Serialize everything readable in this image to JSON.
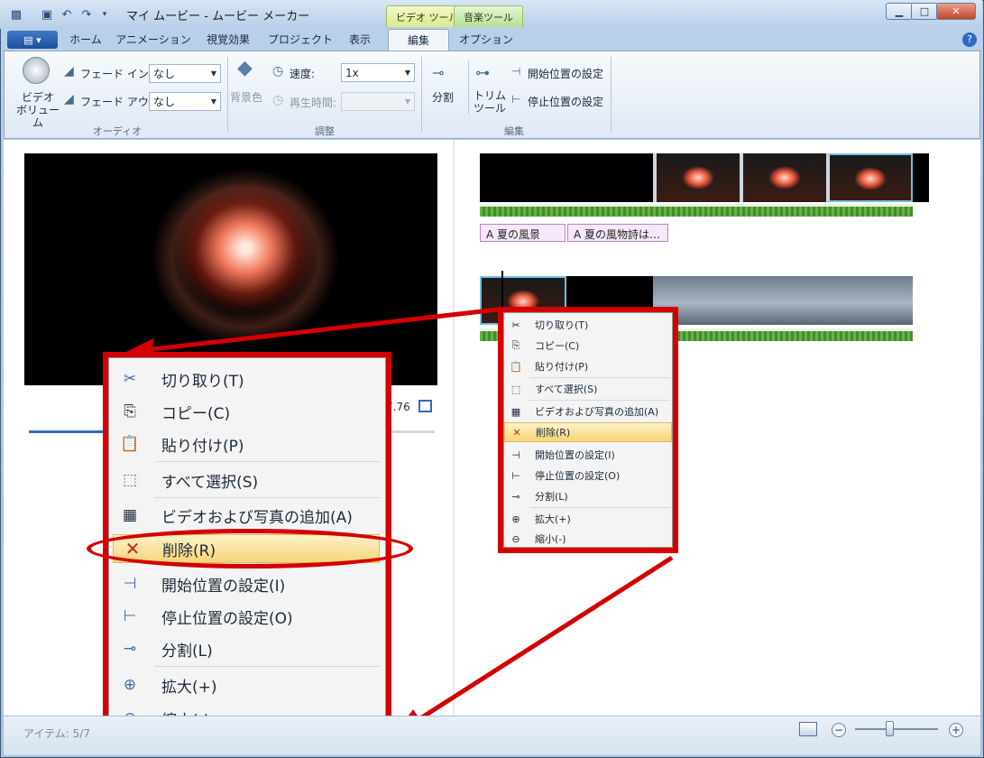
{
  "window": {
    "title": "マイ ムービー - ムービー メーカー",
    "context_tabs": [
      "ビデオ ツール",
      "音楽ツール"
    ],
    "controls": {
      "minimize": "▁",
      "maximize": "□",
      "close": "✕"
    }
  },
  "ribbon": {
    "app_menu_label": "▤ ▾",
    "tabs": [
      "ホーム",
      "アニメーション",
      "視覚効果",
      "プロジェクト",
      "表示",
      "編集",
      "オプション"
    ],
    "active_tab": "編集",
    "help": "?",
    "audio": {
      "video_volume": "ビデオ\nボリューム",
      "fade_in_label": "フェード イン:",
      "fade_in_value": "なし",
      "fade_out_label": "フェード アウト:",
      "fade_out_value": "なし",
      "group": "オーディオ"
    },
    "adjust": {
      "background_color": "背景色",
      "speed_label": "速度:",
      "speed_value": "1x",
      "duration_label": "再生時間:",
      "duration_value": "",
      "group": "調整"
    },
    "edit": {
      "split": "分割",
      "trim_tool": "トリム\nツール",
      "set_start": "開始位置の設定",
      "set_end": "停止位置の設定",
      "group": "編集"
    }
  },
  "preview": {
    "time_fragment": "7.76"
  },
  "storyboard": {
    "captions": [
      "A 夏の風景",
      "A 夏の風物詩は…"
    ]
  },
  "context_menu_items": [
    {
      "icon": "✂",
      "label": "切り取り(T)"
    },
    {
      "icon": "⎘",
      "label": "コピー(C)"
    },
    {
      "icon": "📋",
      "label": "貼り付け(P)"
    },
    {
      "icon": "⬚",
      "label": "すべて選択(S)"
    },
    {
      "icon": "▦",
      "label": "ビデオおよび写真の追加(A)"
    },
    {
      "icon": "✕",
      "label": "削除(R)",
      "highlighted": true
    },
    {
      "icon": "⊣",
      "label": "開始位置の設定(I)"
    },
    {
      "icon": "⊢",
      "label": "停止位置の設定(O)"
    },
    {
      "icon": "⊸",
      "label": "分割(L)"
    },
    {
      "icon": "⊕",
      "label": "拡大(+)"
    },
    {
      "icon": "⊖",
      "label": "縮小(-)"
    }
  ],
  "status": {
    "items": "アイテム: 5/7",
    "zoom_out": "−",
    "zoom_in": "+"
  },
  "colors": {
    "annotation_red": "#d40000",
    "highlight": "#f7d57a",
    "accent": "#2f6ac0"
  }
}
